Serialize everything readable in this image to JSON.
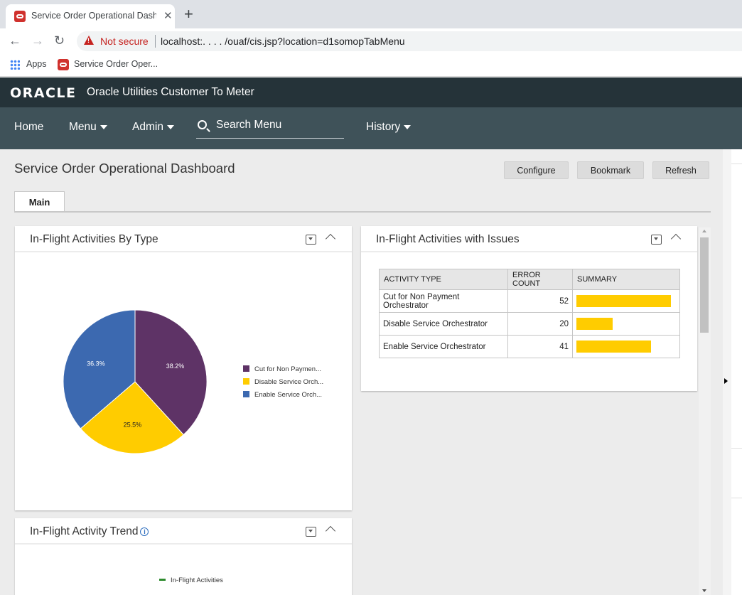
{
  "browser": {
    "tab_title": "Service Order Operational Dashb",
    "close_glyph": "✕",
    "new_tab_glyph": "+",
    "back_glyph": "←",
    "forward_glyph": "→",
    "reload_glyph": "↻",
    "security_label": "Not secure",
    "url": "localhost:. . . . /ouaf/cis.jsp?location=d1somopTabMenu",
    "bookmarks": [
      {
        "label": "Apps",
        "icon": "apps-grid-icon"
      },
      {
        "label": "Service Order Oper...",
        "icon": "oracle-favicon"
      }
    ]
  },
  "app": {
    "logo": "ORACLE",
    "product_name": "Oracle Utilities Customer To Meter",
    "nav": {
      "home": "Home",
      "menu": "Menu",
      "admin": "Admin",
      "search_placeholder": "Search Menu",
      "history": "History"
    }
  },
  "page": {
    "title": "Service Order Operational Dashboard",
    "buttons": {
      "configure": "Configure",
      "bookmark": "Bookmark",
      "refresh": "Refresh"
    },
    "tabs": [
      {
        "label": "Main",
        "active": true
      }
    ]
  },
  "portals": {
    "by_type": {
      "title": "In-Flight Activities By Type"
    },
    "issues": {
      "title": "In-Flight Activities with Issues",
      "columns": [
        "ACTIVITY TYPE",
        "ERROR COUNT",
        "SUMMARY"
      ],
      "rows": [
        {
          "activity_type": "Cut for Non Payment Orchestrator",
          "error_count": 52
        },
        {
          "activity_type": "Disable Service Orchestrator",
          "error_count": 20
        },
        {
          "activity_type": "Enable Service Orchestrator",
          "error_count": 41
        }
      ],
      "bar_color": "#ffcc00"
    },
    "trend": {
      "title": "In-Flight Activity Trend",
      "legend": "In-Flight Activities",
      "legend_color": "#2e8b2e"
    }
  },
  "chart_data": {
    "type": "pie",
    "slices": [
      {
        "label": "Cut for Non Paymen...",
        "value": 38.2,
        "display": "38.2%",
        "color": "#5e3366"
      },
      {
        "label": "Disable Service Orch...",
        "value": 25.5,
        "display": "25.5%",
        "color": "#ffcc00"
      },
      {
        "label": "Enable Service Orch...",
        "value": 36.3,
        "display": "36.3%",
        "color": "#3c69b0"
      }
    ],
    "legend_position": "right"
  },
  "colors": {
    "header_dark": "#253339",
    "nav_bar": "#3f5259",
    "page_bg": "#ececec"
  }
}
